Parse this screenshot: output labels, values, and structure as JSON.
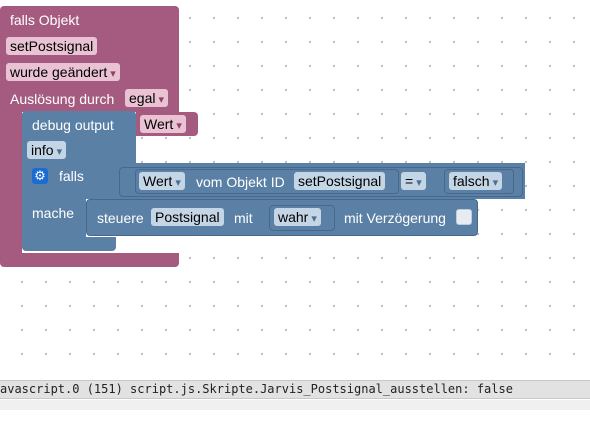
{
  "trigger": {
    "header": "falls Objekt",
    "object_id": "setPostsignal",
    "condition": "wurde geändert",
    "trigger_label": "Auslösung durch",
    "trigger_value": "egal"
  },
  "debug": {
    "label": "debug output",
    "value": "Wert",
    "level": "info"
  },
  "if_block": {
    "falls_label": "falls",
    "mache_label": "mache",
    "value_label": "Wert",
    "from_object_label": "vom Objekt ID",
    "object_id": "setPostsignal",
    "operator": "=",
    "compare_value": "falsch"
  },
  "control": {
    "label": "steuere",
    "object_id": "Postsignal",
    "with_label": "mit",
    "value": "wahr",
    "delay_label": "mit Verzögerung"
  },
  "console": {
    "text": "avascript.0 (151) script.js.Skripte.Jarvis_Postsignal_ausstellen: false"
  },
  "colors": {
    "event_block": "#a55b80",
    "logic_block": "#5b80a5",
    "gear": "#1c6bd2"
  }
}
